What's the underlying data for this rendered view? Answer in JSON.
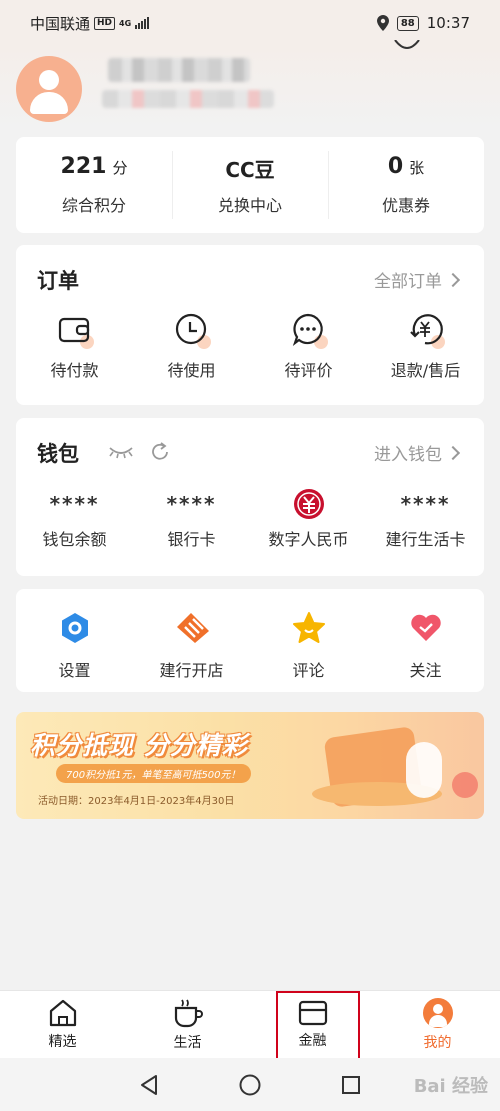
{
  "status_bar": {
    "carrier": "中国联通",
    "hd": "HD",
    "network": "4G",
    "battery": "88",
    "time": "10:37"
  },
  "points": [
    {
      "value": "221",
      "unit": "分",
      "label": "综合积分"
    },
    {
      "value": "CC豆",
      "unit": "",
      "label": "兑换中心"
    },
    {
      "value": "0",
      "unit": "张",
      "label": "优惠券"
    }
  ],
  "orders": {
    "title": "订单",
    "link": "全部订单",
    "items": [
      {
        "label": "待付款",
        "icon": "wallet-icon"
      },
      {
        "label": "待使用",
        "icon": "clock-icon"
      },
      {
        "label": "待评价",
        "icon": "comment-icon"
      },
      {
        "label": "退款/售后",
        "icon": "refund-icon"
      }
    ]
  },
  "wallet": {
    "title": "钱包",
    "link": "进入钱包",
    "items": [
      {
        "value": "****",
        "label": "钱包余额"
      },
      {
        "value": "****",
        "label": "银行卡"
      },
      {
        "value": "",
        "label": "数字人民币"
      },
      {
        "value": "****",
        "label": "建行生活卡"
      }
    ]
  },
  "misc": [
    {
      "label": "设置",
      "icon": "settings-icon",
      "color": "#2e8be6"
    },
    {
      "label": "建行开店",
      "icon": "store-icon",
      "color": "#f0702a"
    },
    {
      "label": "评论",
      "icon": "star-icon",
      "color": "#f7b500"
    },
    {
      "label": "关注",
      "icon": "heart-icon",
      "color": "#f0566a"
    }
  ],
  "banner": {
    "title": "积分抵现 分分精彩",
    "subtitle": "700积分抵1元，单笔至高可抵500元！",
    "date": "活动日期：2023年4月1日-2023年4月30日"
  },
  "bottom_nav": [
    {
      "label": "精选",
      "icon": "home-icon",
      "active": false
    },
    {
      "label": "生活",
      "icon": "coffee-cup-icon",
      "active": false
    },
    {
      "label": "金融",
      "icon": "card-icon",
      "active": false
    },
    {
      "label": "我的",
      "icon": "user-avatar-icon",
      "active": true
    }
  ],
  "watermark": "Bai 经验",
  "colors": {
    "accent": "#f06a2c",
    "highlight_box": "#d0021b",
    "digital_rmb": "#c8102e"
  }
}
